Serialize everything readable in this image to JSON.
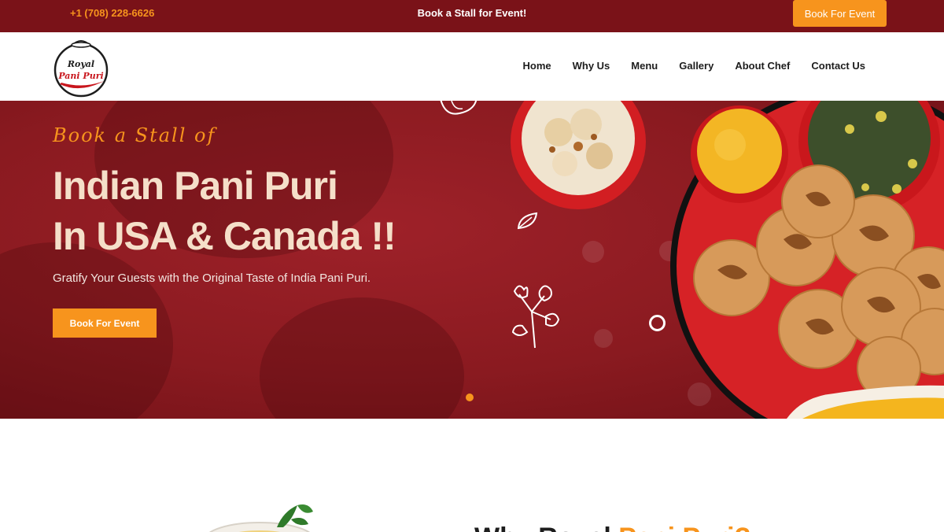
{
  "topbar": {
    "phone": "+1 (708) 228-6626",
    "promo": "Book a Stall for Event!",
    "book_button": "Book For Event"
  },
  "logo": {
    "line1": "Royal",
    "line2": "Pani Puri"
  },
  "nav": {
    "items": [
      "Home",
      "Why Us",
      "Menu",
      "Gallery",
      "About Chef",
      "Contact Us"
    ]
  },
  "hero": {
    "kicker": "Book a Stall of",
    "headline_line1": "Indian Pani Puri",
    "headline_line2": "In USA & Canada !!",
    "subtitle": "Gratify Your Guests with the Original Taste of India Pani Puri.",
    "cta": "Book For Event"
  },
  "section": {
    "title_part1": "Why Royal ",
    "title_part2": "Pani Puri?"
  },
  "colors": {
    "brand_red": "#7a1218",
    "accent_orange": "#f7941d",
    "hero_text": "#f5dfc9"
  }
}
